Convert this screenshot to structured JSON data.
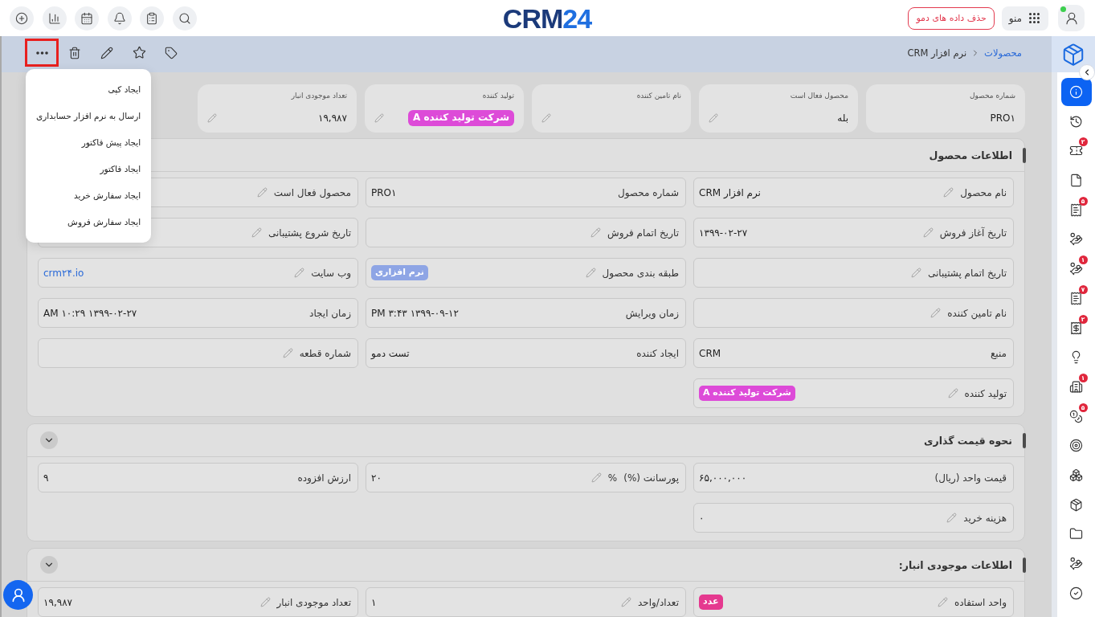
{
  "top_bar": {
    "logo": {
      "text": "CRM",
      "number": "24"
    },
    "demo_button": "حذف داده های دمو",
    "menu_button": "منو",
    "user_online": true
  },
  "toolbar": {
    "more_button": {
      "highlighted": true
    },
    "breadcrumb": [
      {
        "label": "محصولات",
        "current": false
      },
      {
        "label": "نرم افزار CRM",
        "current": true
      }
    ]
  },
  "actions_menu": {
    "items": [
      "ایجاد کپی",
      "ارسال به نرم افزار حسابداری",
      "ایجاد پیش فاکتور",
      "ایجاد فاکتور",
      "ایجاد سفارش خرید",
      "ایجاد سفارش فروش"
    ]
  },
  "summary_cards": [
    {
      "label": "شماره محصول",
      "editable": false,
      "kind": "text",
      "value": "PRO۱"
    },
    {
      "label": "محصول فعال است",
      "editable": true,
      "kind": "text",
      "value": "بله"
    },
    {
      "label": "نام تامین کننده",
      "editable": true
    },
    {
      "label": "تولید کننده",
      "editable": true,
      "kind": "tag",
      "value": "شرکت تولید کننده A",
      "color": "#dd4bd8"
    },
    {
      "label": "تعداد موجودی انبار",
      "editable": true,
      "kind": "text",
      "value": "۱۹,۹۸۷"
    }
  ],
  "sections": [
    {
      "title": "اطلاعات محصول",
      "fields": [
        {
          "label": "نام محصول",
          "editable": true,
          "kind": "text",
          "value": "نرم افزار CRM"
        },
        {
          "label": "شماره محصول",
          "editable": false,
          "kind": "text",
          "value": "PRO۱"
        },
        {
          "label": "محصول فعال است",
          "editable": true
        },
        {
          "label": "تاریخ آغاز فروش",
          "editable": true,
          "kind": "text",
          "value": "۱۳۹۹-۰۲-۲۷"
        },
        {
          "label": "تاریخ اتمام فروش",
          "editable": true
        },
        {
          "label": "تاریخ شروع پشتیبانی",
          "editable": true
        },
        {
          "label": "تاریخ اتمام پشتیبانی",
          "editable": true
        },
        {
          "label": "طبقه بندی محصول",
          "editable": true,
          "kind": "tag",
          "value": "نرم افزاری",
          "color": "#8ea5e5"
        },
        {
          "label": "وب سایت",
          "editable": true,
          "kind": "link",
          "value": "crm۲۴.io"
        },
        {
          "label": "نام تامین کننده",
          "editable": true
        },
        {
          "label": "زمان ویرایش",
          "editable": false,
          "kind": "text",
          "value": "۱۳۹۹-۰۹-۱۲ ۳:۴۳ PM"
        },
        {
          "label": "زمان ایجاد",
          "editable": false,
          "kind": "text",
          "value": "۱۳۹۹-۰۲-۲۷ ۱۰:۲۹ AM"
        },
        {
          "label": "منبع",
          "editable": false,
          "kind": "text",
          "value": "CRM"
        },
        {
          "label": "ایجاد کننده",
          "editable": false,
          "kind": "text",
          "value": "تست دمو"
        },
        {
          "label": "شماره قطعه",
          "editable": true
        },
        {
          "label": "تولید کننده",
          "editable": true,
          "kind": "tag",
          "value": "شرکت تولید کننده A",
          "color": "#dd4bd8"
        }
      ]
    },
    {
      "title": "نحوه قیمت گذاری",
      "expanded": true,
      "fields": [
        {
          "label": "قیمت واحد (ریال)",
          "editable": false,
          "kind": "text",
          "value": "۶۵,۰۰۰,۰۰۰"
        },
        {
          "label": "پورسانت (%)",
          "unit": "%",
          "editable": true,
          "kind": "text",
          "value": "۲۰"
        },
        {
          "label": "ارزش افزوده",
          "editable": false,
          "kind": "text",
          "value": "۹"
        },
        {
          "label": "هزینه خرید",
          "editable": true,
          "kind": "text",
          "value": "۰"
        }
      ]
    },
    {
      "title": "اطلاعات موجودی انبار:",
      "expanded": true,
      "fields": [
        {
          "label": "واحد استفاده",
          "editable": true,
          "kind": "tag",
          "value": "عدد",
          "color": "#e5398f"
        },
        {
          "label": "تعداد/واحد",
          "editable": true,
          "kind": "text",
          "value": "۱"
        },
        {
          "label": "تعداد موجودی انبار",
          "editable": true,
          "kind": "text",
          "value": "۱۹,۹۸۷"
        }
      ]
    }
  ],
  "sidebar": {
    "items": [
      {
        "selected": true
      },
      {
        "selected": false
      },
      {
        "selected": false,
        "badge": "۲"
      },
      {
        "selected": false
      },
      {
        "selected": false,
        "badge": "۵"
      },
      {
        "selected": false
      },
      {
        "selected": false,
        "badge": "۱"
      },
      {
        "selected": false,
        "badge": "۷"
      },
      {
        "selected": false,
        "badge": "۲"
      },
      {
        "selected": false
      },
      {
        "selected": false,
        "badge": "۱"
      },
      {
        "selected": false,
        "badge": "۵"
      },
      {
        "selected": false
      },
      {
        "selected": false
      },
      {
        "selected": false
      },
      {
        "selected": false
      },
      {
        "selected": false
      },
      {
        "selected": false
      }
    ]
  }
}
